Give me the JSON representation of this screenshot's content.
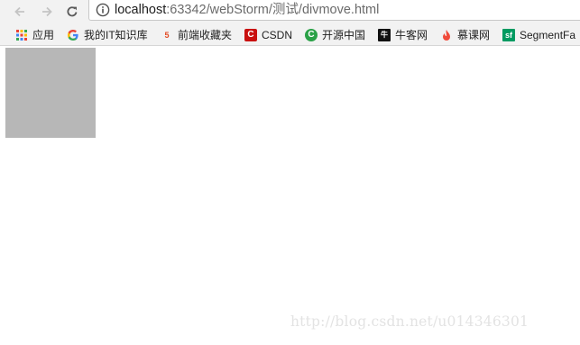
{
  "browser": {
    "url_host": "localhost",
    "url_rest": ":63342/webStorm/测试/divmove.html"
  },
  "bookmarks": [
    {
      "label": "应用",
      "icon": "apps-grid-icon"
    },
    {
      "label": "我的IT知识库",
      "icon": "google-g-icon"
    },
    {
      "label": "前端收藏夹",
      "icon": "html5-icon"
    },
    {
      "label": "CSDN",
      "icon": "csdn-icon"
    },
    {
      "label": "开源中国",
      "icon": "oschina-icon"
    },
    {
      "label": "牛客网",
      "icon": "nowcoder-icon"
    },
    {
      "label": "慕课网",
      "icon": "imooc-flame-icon"
    },
    {
      "label": "SegmentFa",
      "icon": "segmentfault-icon"
    }
  ],
  "colors": {
    "movable_box": "#b7b7b7",
    "csdn": "#c9100f",
    "oschina": "#2aa147",
    "segmentfault": "#009a61"
  },
  "watermark": "http://blog.csdn.net/u014346301"
}
